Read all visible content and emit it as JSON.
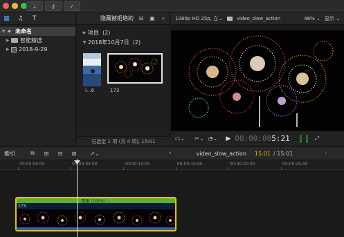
{
  "titlebar": {
    "buttons": [
      {
        "name": "import-media-button",
        "icon": "download-icon",
        "glyph": "⇣"
      },
      {
        "name": "keywords-button",
        "icon": "key-icon",
        "glyph": "⚷"
      },
      {
        "name": "background-tasks-button",
        "icon": "checkmark-circle-icon",
        "glyph": "✓"
      }
    ]
  },
  "library": {
    "toolbar_icons": [
      {
        "name": "libraries-icon",
        "glyph": "▦"
      },
      {
        "name": "photos-audio-icon",
        "glyph": "♫"
      },
      {
        "name": "titles-generators-icon",
        "glyph": "T"
      }
    ],
    "items": [
      {
        "label": "未命名",
        "level": 0,
        "selected": true
      },
      {
        "label": "智能精选",
        "level": 1,
        "selected": false
      },
      {
        "label": "2018-9-29",
        "level": 1,
        "selected": false
      }
    ]
  },
  "browser": {
    "filter": "隐藏被拒绝的",
    "sections": [
      {
        "label": "项目",
        "count": "(2)",
        "expanded": false
      },
      {
        "label": "2018年10月7日",
        "count": "(2)",
        "expanded": true
      }
    ],
    "clips": [
      {
        "label": "I...6"
      },
      {
        "label": "173"
      }
    ],
    "status": "已选定 1 项 (共 4 项), 15:01"
  },
  "viewer": {
    "format": "1080p HD 25p, 立...",
    "clip_name": "video_slow_action",
    "zoom": "46%",
    "display": "显示",
    "timecode_dim": "00:00:00",
    "timecode": "5:21"
  },
  "timeline": {
    "index_label": "索引",
    "project_name": "video_slow_action",
    "current_tc": "15:01",
    "total_tc": "/ 15:01",
    "ruler": [
      "00:00:00:00",
      "00:00:05:00",
      "00:00:10:00",
      "00:00:15:00",
      "00:00:20:00",
      "00:00:25:00"
    ],
    "clip": {
      "speed_label": "常速 (100%) ⌄",
      "name": "173"
    }
  },
  "colors": {
    "accent_blue": "#4ea3ff",
    "clip_border": "#e8c200",
    "retime_green": "#5fae2e",
    "timecode_yellow": "#e6b500"
  }
}
